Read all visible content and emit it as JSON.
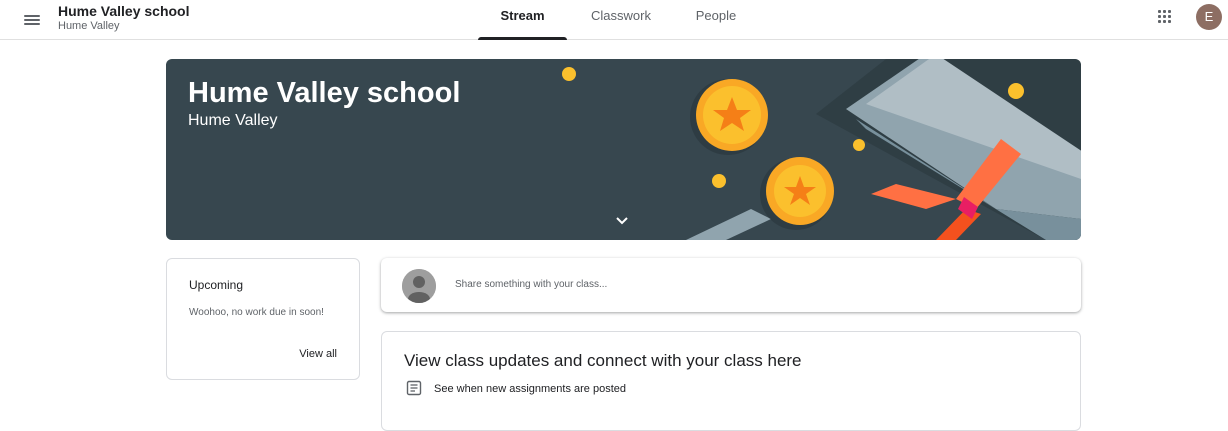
{
  "header": {
    "class_name": "Hume Valley school",
    "section": "Hume Valley",
    "tabs": [
      {
        "label": "Stream",
        "active": true
      },
      {
        "label": "Classwork",
        "active": false
      },
      {
        "label": "People",
        "active": false
      }
    ],
    "avatar_letter": "E",
    "icons": {
      "menu": "hamburger-menu-icon",
      "apps": "google-apps-grid-icon"
    }
  },
  "banner": {
    "title": "Hume Valley school",
    "subtitle": "Hume Valley",
    "background_color": "#37474f",
    "expand_icon": "chevron-down-icon"
  },
  "upcoming": {
    "title": "Upcoming",
    "message": "Woohoo, no work due in soon!",
    "view_all": "View all"
  },
  "share": {
    "placeholder": "Share something with your class..."
  },
  "updates": {
    "title": "View class updates and connect with your class here",
    "item": "See when new assignments are posted",
    "item_icon": "assignment-icon"
  },
  "colors": {
    "accent": "#202124",
    "avatar": "#8d6e63"
  }
}
